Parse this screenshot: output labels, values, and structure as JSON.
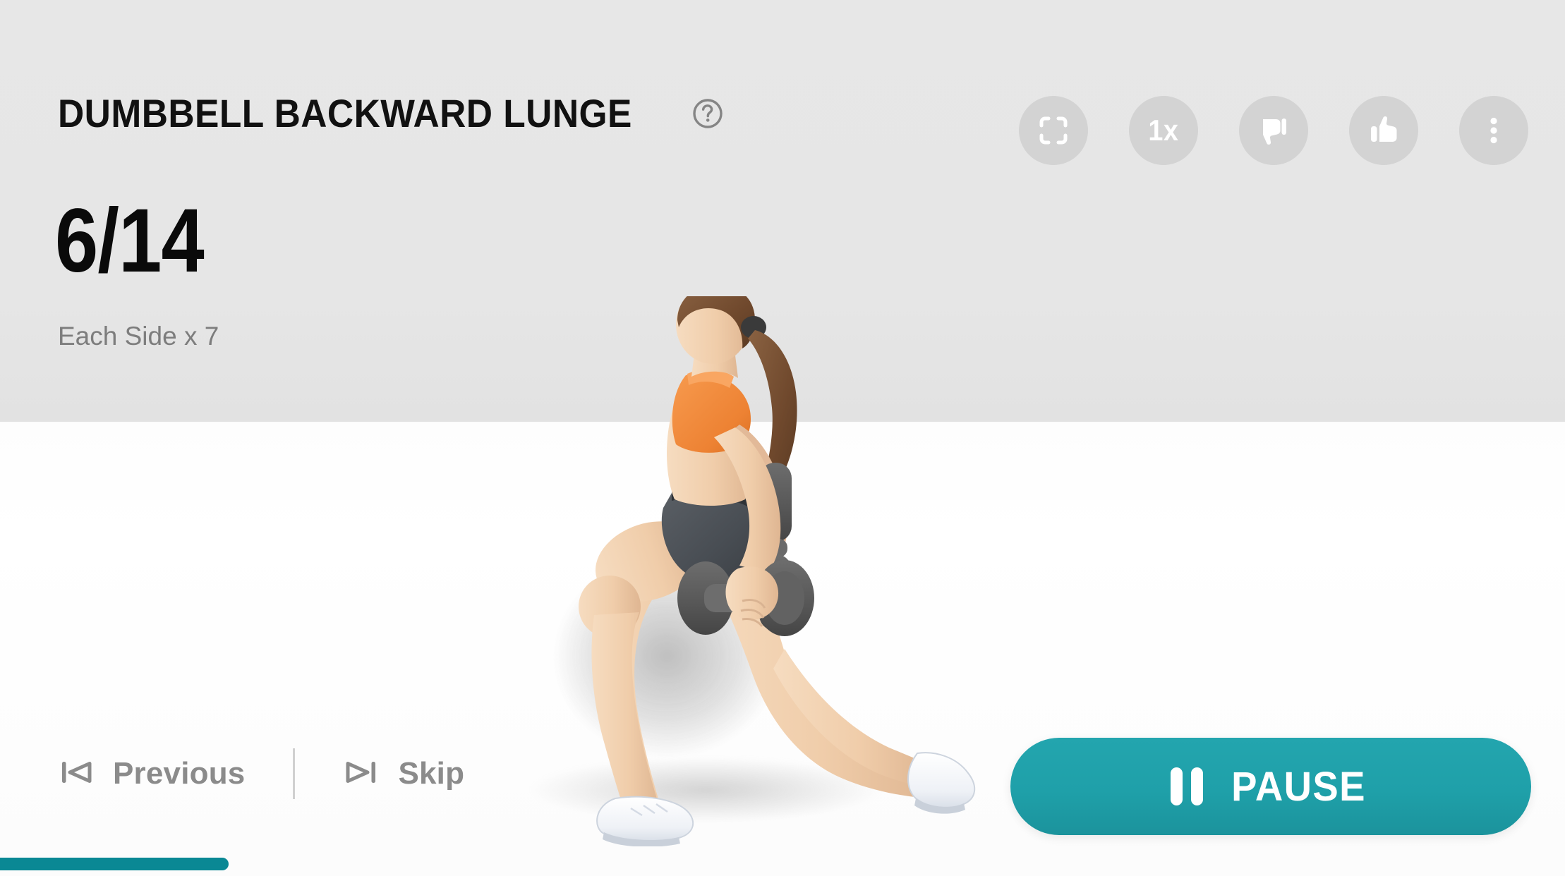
{
  "exercise": {
    "title": "DUMBBELL BACKWARD LUNGE",
    "help_icon": "question-circle-icon",
    "rep_counter": "6/14",
    "rep_detail": "Each Side x 7",
    "current_rep": 6,
    "total_reps": 14,
    "per_side_reps": 7
  },
  "toolbar": {
    "items": [
      {
        "name": "fullscreen-button",
        "icon": "fullscreen-frame-icon",
        "label": ""
      },
      {
        "name": "speed-button",
        "icon": "speed-icon",
        "label": "1x"
      },
      {
        "name": "thumbs-down-button",
        "icon": "thumbs-down-icon",
        "label": ""
      },
      {
        "name": "thumbs-up-button",
        "icon": "thumbs-up-icon",
        "label": ""
      },
      {
        "name": "more-options-button",
        "icon": "three-dot-menu-icon",
        "label": ""
      }
    ],
    "speed_value": "1x"
  },
  "controls": {
    "previous_label": "Previous",
    "previous_icon": "skip-back-icon",
    "skip_label": "Skip",
    "skip_icon": "skip-forward-icon",
    "pause_label": "PAUSE",
    "pause_icon": "pause-icon"
  },
  "progress": {
    "percent": 14.6
  },
  "colors": {
    "accent_teal": "#21a3ac",
    "progress_teal": "#0a8894",
    "header_gray": "#e6e6e6",
    "icon_gray": "#d3d3d3",
    "muted_text": "#7d7d7d",
    "nav_text": "#8b8b8b",
    "title_black": "#111111",
    "sports_bra_orange": "#f08a3c",
    "shorts_dark": "#4b4f54",
    "dumbbell_gray": "#5a5a5a",
    "skin_tone": "#f0cdaa",
    "hair_brown": "#7a5436",
    "shoe_white": "#f2f4f8"
  }
}
